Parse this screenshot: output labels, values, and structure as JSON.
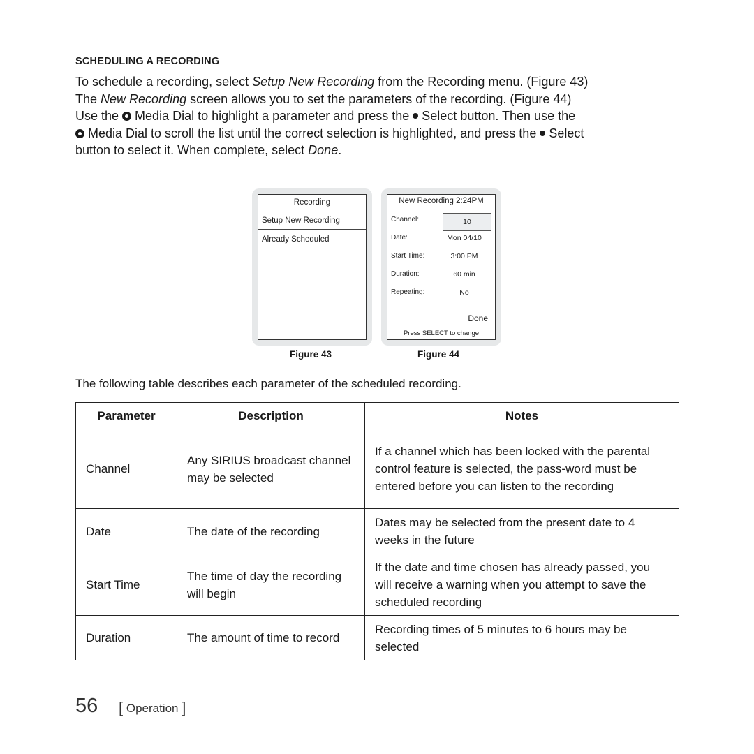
{
  "section": {
    "heading": "SCHEDULING A RECORDING",
    "para": [
      "To schedule a recording, select ",
      "Setup New Recording",
      " from the Recording menu. (Figure 43)",
      "The ",
      "New Recording",
      " screen allows you to set the parameters of the recording. (Figure 44)",
      "Use the ",
      " Media Dial to highlight a parameter and press the ",
      " Select button. Then use the",
      " Media Dial to scroll the list until the correct selection is highlighted, and press the ",
      " Select",
      "button to select it. When complete, select ",
      "Done",
      "."
    ]
  },
  "figure43": {
    "title": "Recording",
    "selected_item": "Setup New Recording",
    "items": [
      "Already Scheduled"
    ],
    "caption": "Figure 43"
  },
  "figure44": {
    "title": "New Recording 2:24PM",
    "rows": [
      {
        "label": "Channel:",
        "value": "10"
      },
      {
        "label": "Date:",
        "value": "Mon 04/10"
      },
      {
        "label": "Start Time:",
        "value": "3:00 PM"
      },
      {
        "label": "Duration:",
        "value": "60 min"
      },
      {
        "label": "Repeating:",
        "value": "No"
      }
    ],
    "done": "Done",
    "hint": "Press SELECT to change",
    "caption": "Figure 44"
  },
  "table": {
    "intro": "The following table describes each parameter of the scheduled recording.",
    "headers": [
      "Parameter",
      "Description",
      "Notes"
    ],
    "rows": [
      {
        "parameter": "Channel",
        "description": "Any SIRIUS broadcast channel may be selected",
        "notes": "If a channel which has been locked with the parental control feature is selected, the pass-word must be entered before you can listen to the recording"
      },
      {
        "parameter": "Date",
        "description": "The date of the recording",
        "notes": "Dates may be selected from the present date to 4 weeks in the future"
      },
      {
        "parameter": "Start Time",
        "description": "The time of day the recording will begin",
        "notes": "If the date and time chosen has already passed, you will receive a warning when you attempt to save the scheduled recording"
      },
      {
        "parameter": "Duration",
        "description": "The amount of time to record",
        "notes": "Recording times of 5 minutes to 6 hours may be selected"
      }
    ]
  },
  "footer": {
    "page_number": "56",
    "section": "Operation"
  }
}
